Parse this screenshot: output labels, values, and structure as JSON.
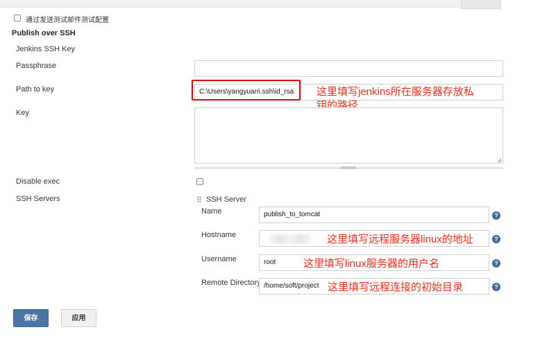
{
  "top_option": {
    "label": "通过发送测试邮件测试配置"
  },
  "section": {
    "title": "Publish over SSH"
  },
  "fields": {
    "jenkins_ssh_key_label": "Jenkins SSH Key",
    "passphrase_label": "Passphrase",
    "passphrase_value": "",
    "path_to_key_label": "Path to key",
    "path_to_key_value": "C:\\Users\\yangyuan\\.ssh\\id_rsa",
    "key_label": "Key",
    "key_value": "",
    "disable_exec_label": "Disable exec",
    "ssh_servers_label": "SSH Servers"
  },
  "ssh_server": {
    "header": "SSH Server",
    "name_label": "Name",
    "name_value": "publish_to_tomcat",
    "hostname_label": "Hostname",
    "hostname_value": "",
    "username_label": "Username",
    "username_value": "root",
    "remote_directory_label": "Remote Directory",
    "remote_directory_value": "/home/soft/project",
    "help_glyph": "?"
  },
  "annotations": {
    "path_to_key_line1": "这里填写jenkins所在服务器存放私",
    "path_to_key_line2": "钥的路径",
    "hostname": "这里填写远程服务器linux的地址",
    "username": "这里填写linux服务器的用户名",
    "remote_directory": "这里填写远程连接的初始目录"
  },
  "buttons": {
    "save": "保存",
    "apply": "应用"
  },
  "colors": {
    "annotation_red": "#ff2a1a",
    "primary_button": "#4b75a6",
    "help_icon": "#3d6a9e"
  }
}
